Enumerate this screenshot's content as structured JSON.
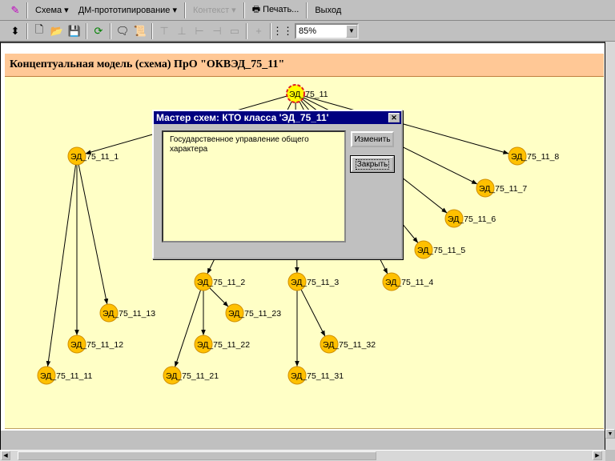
{
  "menu": {
    "items": [
      {
        "label": "Схема ▾"
      },
      {
        "label": "ДМ-прототипирование ▾"
      },
      {
        "label": "Контекст ▾",
        "disabled": true
      },
      {
        "label": "Печать..."
      },
      {
        "label": "Выход"
      }
    ]
  },
  "toolbar": {
    "zoom_value": "85%"
  },
  "header": {
    "title": "Концептуальная модель (схема) ПрО  \"ОКВЭД_75_11\""
  },
  "dialog": {
    "title": "Мастер схем: КТО класса 'ЭД_75_11'",
    "text": "Государственное управление общего характера",
    "edit_label": "Изменить",
    "close_label": "Закрыть"
  },
  "diagram": {
    "colors": {
      "node": "#ffc000",
      "selected": "#ffff00",
      "edge": "#000000"
    },
    "nodes": [
      {
        "id": "root",
        "label": "ЭД_75_11",
        "selected": true
      },
      {
        "id": "n1",
        "label": "ЭД_75_11_1"
      },
      {
        "id": "n2",
        "label": "ЭД_75_11_2"
      },
      {
        "id": "n3",
        "label": "ЭД_75_11_3"
      },
      {
        "id": "n4",
        "label": "ЭД_75_11_4"
      },
      {
        "id": "n5",
        "label": "ЭД_75_11_5"
      },
      {
        "id": "n6",
        "label": "ЭД_75_11_6"
      },
      {
        "id": "n7",
        "label": "ЭД_75_11_7"
      },
      {
        "id": "n8",
        "label": "ЭД_75_11_8"
      },
      {
        "id": "n11",
        "label": "ЭД_75_11_11"
      },
      {
        "id": "n12",
        "label": "ЭД_75_11_12"
      },
      {
        "id": "n13",
        "label": "ЭД_75_11_13"
      },
      {
        "id": "n21",
        "label": "ЭД_75_11_21"
      },
      {
        "id": "n22",
        "label": "ЭД_75_11_22"
      },
      {
        "id": "n23",
        "label": "ЭД_75_11_23"
      },
      {
        "id": "n31",
        "label": "ЭД_75_11_31"
      },
      {
        "id": "n32",
        "label": "ЭД_75_11_32"
      }
    ],
    "edges": [
      [
        "root",
        "n1"
      ],
      [
        "root",
        "n2"
      ],
      [
        "root",
        "n3"
      ],
      [
        "root",
        "n4"
      ],
      [
        "root",
        "n5"
      ],
      [
        "root",
        "n6"
      ],
      [
        "root",
        "n7"
      ],
      [
        "root",
        "n8"
      ],
      [
        "n1",
        "n11"
      ],
      [
        "n1",
        "n12"
      ],
      [
        "n1",
        "n13"
      ],
      [
        "n2",
        "n21"
      ],
      [
        "n2",
        "n22"
      ],
      [
        "n2",
        "n23"
      ],
      [
        "n3",
        "n31"
      ],
      [
        "n3",
        "n32"
      ]
    ]
  }
}
